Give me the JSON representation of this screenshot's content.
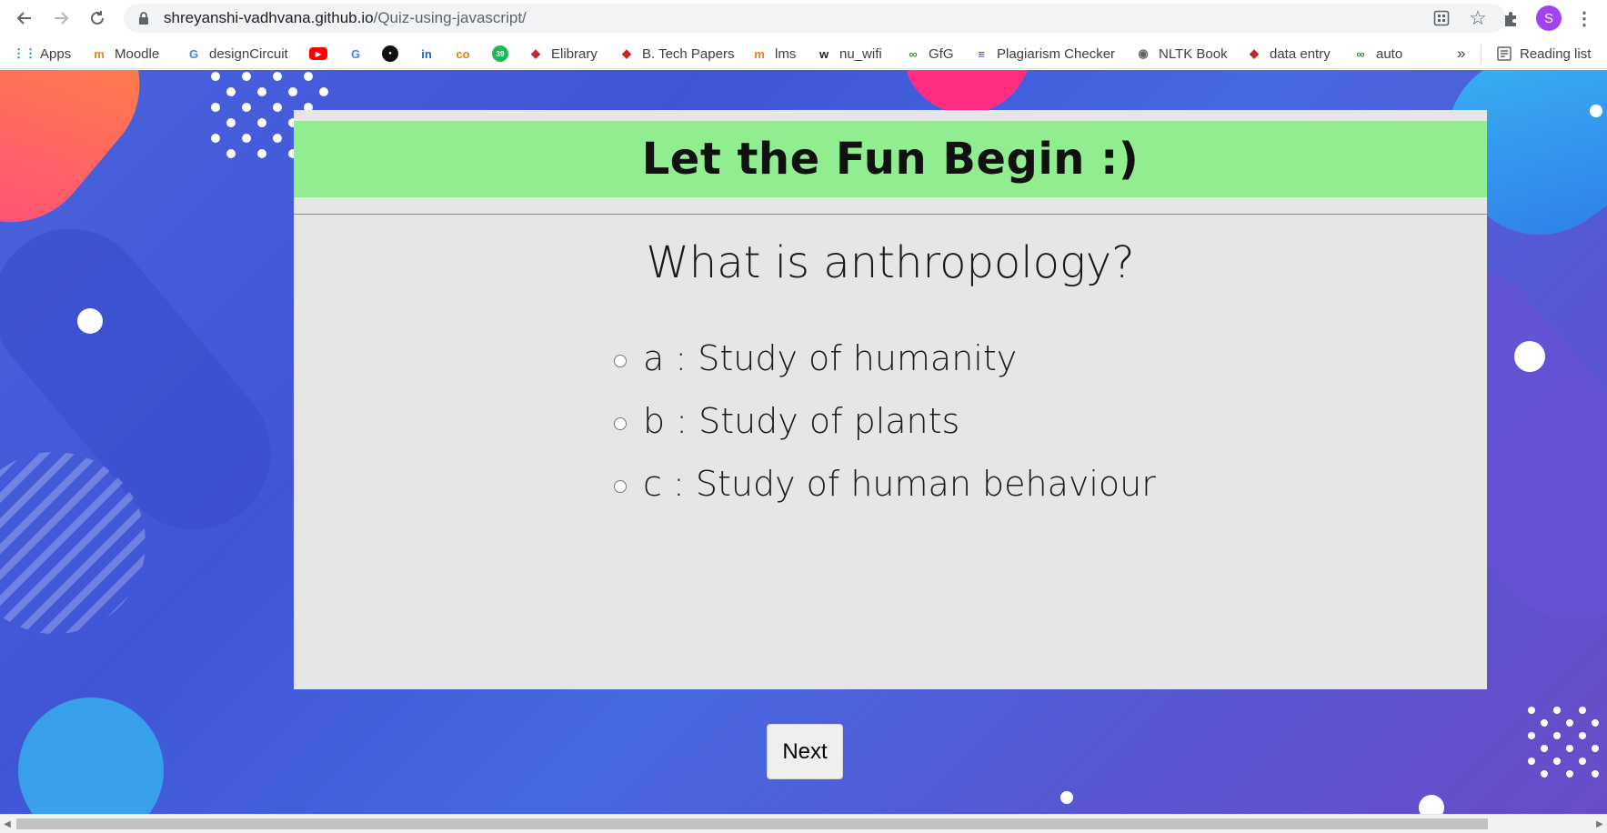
{
  "browser": {
    "url_host": "shreyanshi-vadhvana.github.io",
    "url_path": "/Quiz-using-javascript/",
    "avatar_letter": "S",
    "overflow_label": "»",
    "reading_list_label": "Reading list"
  },
  "bookmarks": [
    {
      "label": "Apps",
      "icon": "apps-grid-icon",
      "color": "#1a73e8"
    },
    {
      "label": "Moodle",
      "icon": "moodle-icon",
      "color": "#f98012"
    },
    {
      "label": "designCircuit",
      "icon": "google-icon",
      "color": "#4285f4"
    },
    {
      "label": "",
      "icon": "youtube-icon",
      "color": "#ff0000"
    },
    {
      "label": "",
      "icon": "google-icon",
      "color": "#4285f4"
    },
    {
      "label": "",
      "icon": "github-icon",
      "color": "#111111"
    },
    {
      "label": "",
      "icon": "linkedin-icon",
      "color": "#0a66c2"
    },
    {
      "label": "",
      "icon": "codechef-icon",
      "color": "#f57c00"
    },
    {
      "label": "",
      "icon": "green-badge-icon",
      "color": "#1db954"
    },
    {
      "label": "Elibrary",
      "icon": "shield-icon",
      "color": "#c62828"
    },
    {
      "label": "B. Tech Papers",
      "icon": "shield-icon",
      "color": "#c62828"
    },
    {
      "label": "lms",
      "icon": "moodle-icon",
      "color": "#f98012"
    },
    {
      "label": "nu_wifi",
      "icon": "wifi-logo-icon",
      "color": "#222222"
    },
    {
      "label": "GfG",
      "icon": "gfg-icon",
      "color": "#2f8d46"
    },
    {
      "label": "Plagiarism Checker",
      "icon": "plagiarism-icon",
      "color": "#3949ab"
    },
    {
      "label": "NLTK Book",
      "icon": "globe-icon",
      "color": "#5f6368"
    },
    {
      "label": "data entry",
      "icon": "shield-icon",
      "color": "#c62828"
    },
    {
      "label": "auto",
      "icon": "gfg-icon",
      "color": "#2f8d46"
    }
  ],
  "quiz": {
    "banner_title": "Let the Fun Begin :)",
    "question": "What is anthropology?",
    "options": [
      {
        "key": "a",
        "label": "a : Study of humanity"
      },
      {
        "key": "b",
        "label": "b : Study of plants"
      },
      {
        "key": "c",
        "label": "c : Study of human behaviour"
      }
    ],
    "next_label": "Next"
  },
  "colors": {
    "banner_green": "#90ee90",
    "card_gray": "#e6e6e6",
    "background_blue": "#4a63dd"
  }
}
